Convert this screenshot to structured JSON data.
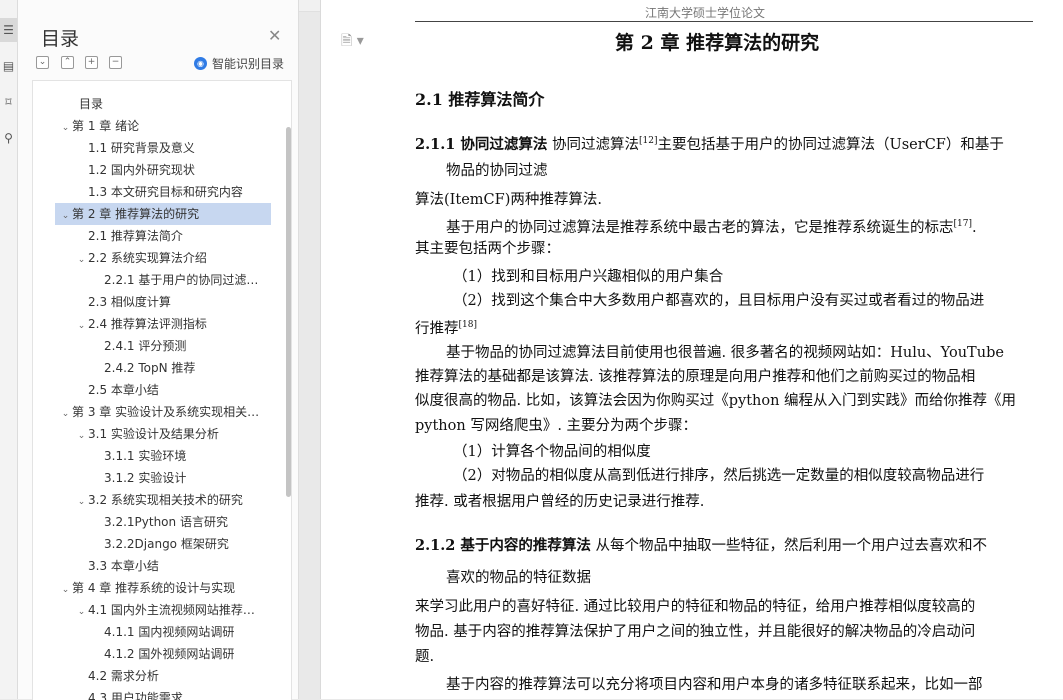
{
  "toolstrip": {
    "buttons": [
      "toc-icon",
      "page-icon",
      "bookmark-icon",
      "search-icon"
    ]
  },
  "nav": {
    "title": "目录",
    "smart_label": "智能识别目录",
    "items": [
      {
        "level": 0,
        "text": "目录",
        "arrow": ""
      },
      {
        "level": 0,
        "text": "第 1 章 绪论",
        "arrow": "v"
      },
      {
        "level": 1,
        "text": "1.1 研究背景及意义",
        "arrow": ""
      },
      {
        "level": 1,
        "text": "1.2 国内外研究现状",
        "arrow": ""
      },
      {
        "level": 1,
        "text": "1.3 本文研究目标和研究内容",
        "arrow": ""
      },
      {
        "level": 0,
        "text": "第 2 章 推荐算法的研究",
        "arrow": "v",
        "selected": true
      },
      {
        "level": 1,
        "text": "2.1 推荐算法简介",
        "arrow": ""
      },
      {
        "level": 1,
        "text": "2.2 系统实现算法介绍",
        "arrow": "v"
      },
      {
        "level": 2,
        "text": "2.2.1 基于用户的协同过滤…",
        "arrow": ""
      },
      {
        "level": 1,
        "text": "2.3 相似度计算",
        "arrow": ""
      },
      {
        "level": 1,
        "text": "2.4 推荐算法评测指标",
        "arrow": "v"
      },
      {
        "level": 2,
        "text": "2.4.1 评分预测",
        "arrow": ""
      },
      {
        "level": 2,
        "text": "2.4.2 TopN 推荐",
        "arrow": ""
      },
      {
        "level": 1,
        "text": "2.5 本章小结",
        "arrow": ""
      },
      {
        "level": 0,
        "text": "第 3 章 实验设计及系统实现相关…",
        "arrow": "v"
      },
      {
        "level": 1,
        "text": "3.1 实验设计及结果分析",
        "arrow": "v"
      },
      {
        "level": 2,
        "text": "3.1.1 实验环境",
        "arrow": ""
      },
      {
        "level": 2,
        "text": "3.1.2 实验设计",
        "arrow": ""
      },
      {
        "level": 1,
        "text": "3.2 系统实现相关技术的研究",
        "arrow": "v"
      },
      {
        "level": 2,
        "text": "3.2.1Python 语言研究",
        "arrow": ""
      },
      {
        "level": 2,
        "text": "3.2.2Django 框架研究",
        "arrow": ""
      },
      {
        "level": 1,
        "text": "3.3 本章小结",
        "arrow": ""
      },
      {
        "level": 0,
        "text": "第 4 章 推荐系统的设计与实现",
        "arrow": "v"
      },
      {
        "level": 1,
        "text": "4.1 国内外主流视频网站推荐…",
        "arrow": "v"
      },
      {
        "level": 2,
        "text": "4.1.1 国内视频网站调研",
        "arrow": ""
      },
      {
        "level": 2,
        "text": "4.1.2 国外视频网站调研",
        "arrow": ""
      },
      {
        "level": 1,
        "text": "4.2 需求分析",
        "arrow": ""
      },
      {
        "level": 1,
        "text": "4.3 用户功能需求",
        "arrow": ""
      }
    ]
  },
  "doc": {
    "header": "江南大学硕士学位论文",
    "chapter": "第 2 章 推荐算法的研究",
    "h21": "2.1  推荐算法简介",
    "h211": "2.1.1 协同过滤算法",
    "p1a": "协同过滤算法",
    "p1sup": "[12]",
    "p1b": "主要包括基于用户的协同过滤算法（UserCF）和基于",
    "p1c": "物品的协同过滤",
    "p2": "算法(ItemCF)两种推荐算法.",
    "p3a": "基于用户的协同过滤算法是推荐系统中最古老的算法，它是推荐系统诞生的标志",
    "p3sup": "[17]",
    "p3b": ".",
    "p4": "其主要包括两个步骤：",
    "p5": "（1）找到和目标用户兴趣相似的用户集合",
    "p6": "（2）找到这个集合中大多数用户都喜欢的，且目标用户没有买过或者看过的物品进",
    "p7a": "行推荐",
    "p7sup": "[18]",
    "p8": "基于物品的协同过滤算法目前使用也很普遍. 很多著名的视频网站如：Hulu、YouTube",
    "p9": "推荐算法的基础都是该算法. 该推荐算法的原理是向用户推荐和他们之前购买过的物品相",
    "p10": "似度很高的物品. 比如，该算法会因为你购买过《python 编程从入门到实践》而给你推荐《用",
    "p11": "python 写网络爬虫》. 主要分为两个步骤：",
    "p12": "（1）计算各个物品间的相似度",
    "p13": "（2）对物品的相似度从高到低进行排序，然后挑选一定数量的相似度较高物品进行",
    "p14": "推荐. 或者根据用户曾经的历史记录进行推荐.",
    "h212": "2.1.2 基于内容的推荐算法",
    "p15": "从每个物品中抽取一些特征，然后利用一个用户过去喜欢和不",
    "p16": "喜欢的物品的特征数据",
    "p17": "来学习此用户的喜好特征. 通过比较用户的特征和物品的特征，给用户推荐相似度较高的",
    "p18": "物品. 基于内容的推荐算法保护了用户之间的独立性，并且能很好的解决物品的冷启动问",
    "p19": "题.",
    "p20": "基于内容的推荐算法可以充分将项目内容和用户本身的诸多特征联系起来，比如一部"
  }
}
